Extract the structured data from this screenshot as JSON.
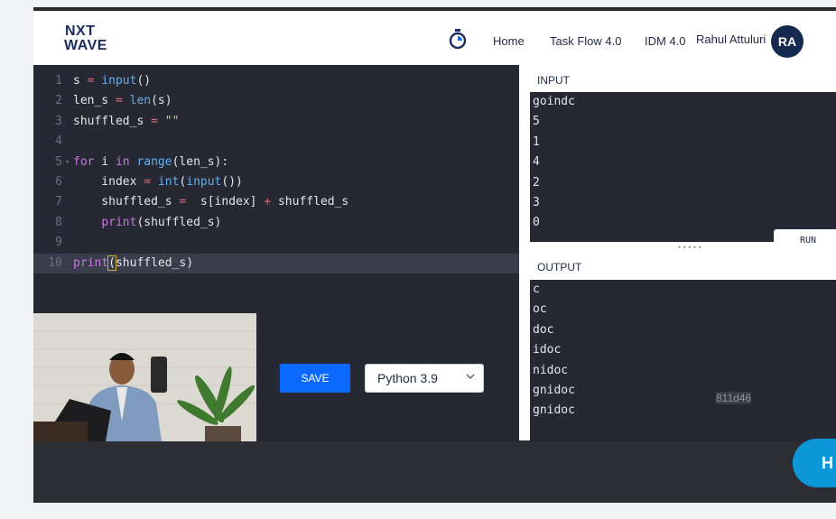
{
  "header": {
    "logo_line1": "NXT",
    "logo_line2": "WAVE",
    "nav": [
      "Home",
      "Task Flow 4.0",
      "IDM 4.0"
    ],
    "user_name": "Rahul Attuluri",
    "avatar_initials": "RA"
  },
  "editor": {
    "lines": [
      {
        "n": "1",
        "html": "s <span class='o'>=</span> <span class='f'>input</span>()"
      },
      {
        "n": "2",
        "html": "len_s <span class='o'>=</span> <span class='f'>len</span>(s)"
      },
      {
        "n": "3",
        "html": "shuffled_s <span class='o'>=</span> <span class='s'>\"\"</span>"
      },
      {
        "n": "4",
        "html": ""
      },
      {
        "n": "5",
        "html": "<span class='k'>for</span> i <span class='k'>in</span> <span class='f'>range</span>(len_s):"
      },
      {
        "n": "6",
        "html": "    index <span class='o'>=</span> <span class='f'>int</span>(<span class='f'>input</span>())"
      },
      {
        "n": "7",
        "html": "    shuffled_s <span class='o'>=</span>  s[index] <span class='o'>+</span> shuffled_s"
      },
      {
        "n": "8",
        "html": "    <span class='k'>print</span>(shuffled_s)"
      },
      {
        "n": "9",
        "html": ""
      },
      {
        "n": "10",
        "html": "<span class='k'>print</span><span class='bracket-hl'>(</span>shuffled_s)"
      }
    ],
    "active_line": "10"
  },
  "actions": {
    "save_label": "SAVE",
    "language": "Python 3.9"
  },
  "input_panel": {
    "title": "INPUT",
    "lines": [
      "goindc",
      "5",
      "1",
      "4",
      "2",
      "3",
      "0"
    ],
    "run_label": "RUN"
  },
  "output_panel": {
    "title": "OUTPUT",
    "lines": [
      "c",
      "oc",
      "doc",
      "idoc",
      "nidoc",
      "gnidoc",
      "gnidoc"
    ],
    "watermark": "811d46"
  },
  "help": {
    "label": "H"
  },
  "colors": {
    "accent": "#0b69ff",
    "editor_bg": "#262834",
    "avatar_bg": "#16294f"
  }
}
